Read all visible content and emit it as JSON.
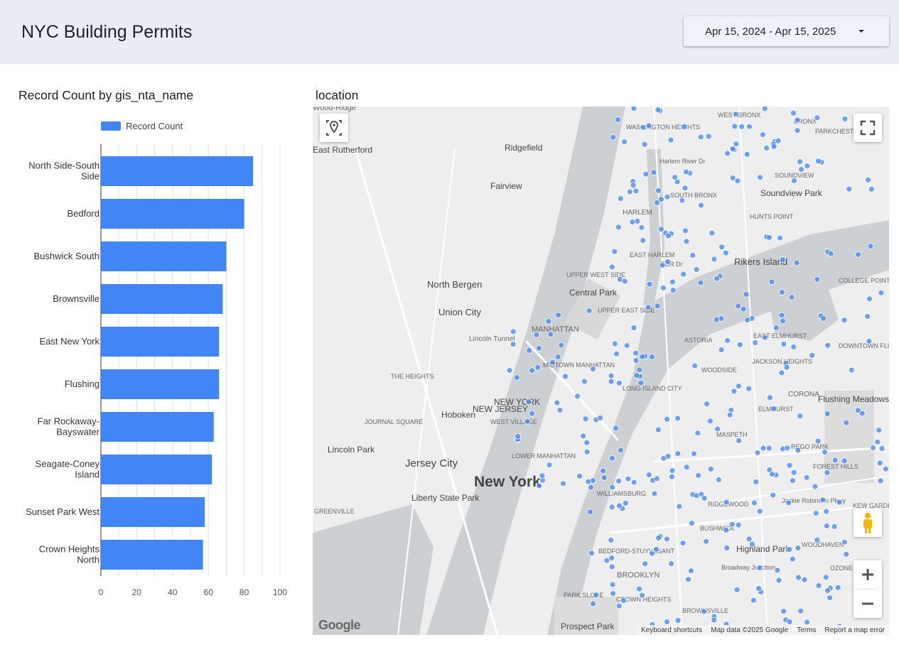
{
  "header": {
    "title": "NYC Building Permits",
    "date_range": "Apr 15, 2024 - Apr 15, 2025"
  },
  "bar_chart": {
    "title": "Record Count by gis_nta_name"
  },
  "map_panel": {
    "title": "location",
    "footer": {
      "shortcuts": "Keyboard shortcuts",
      "map_data": "Map data ©2025 Google",
      "terms": "Terms",
      "report": "Report a map error"
    },
    "logo": "Google",
    "place_labels": [
      "Wood-Ridge",
      "East Rutherford",
      "Ridgefield",
      "Fairview",
      "WASHINGTON HEIGHTS",
      "WEST BRONX",
      "BRONX",
      "PARKCHESTER",
      "SOUNDVIEW",
      "Soundview Park",
      "SOUTH BRONX",
      "HARLEM",
      "HUNTS POINT",
      "EAST HARLEM",
      "Rikers Island",
      "COLLEGE POINT",
      "North Bergen",
      "UPPER WEST SIDE",
      "Central Park",
      "UPPER EAST SIDE",
      "Union City",
      "MANHATTAN",
      "ASTORIA",
      "EAST ELMHURST",
      "JACKSON HEIGHTS",
      "MIDTOWN MANHATTAN",
      "WOODSIDE",
      "THE HEIGHTS",
      "LONG ISLAND CITY",
      "CORONA",
      "Flushing Meadows Corona Park",
      "Hoboken",
      "JOURNAL SQUARE",
      "WEST VILLAGE",
      "ELMHURST",
      "MASPETH",
      "REGO PARK",
      "Lincoln Park",
      "LOWER MANHATTAN",
      "Jersey City",
      "New York",
      "FOREST HILLS",
      "WILLIAMSBURG",
      "Liberty State Park",
      "RIDGEWOOD",
      "GREENVILLE",
      "BUSHWICK",
      "Highland Park",
      "WOODHAVEN",
      "BEDFORD-STUYVESANT",
      "BROOKLYN",
      "OZONE PARK",
      "PARK SLOPE",
      "CROWN HEIGHTS",
      "BROWNSVILLE",
      "Prospect Park",
      "Jackie Robinson Pkwy",
      "Lincoln Tunnel",
      "Harlem River Dr",
      "FDR Dr",
      "NEW JERSEY",
      "NEW YORK",
      "DOWNTOWN FLUSHING",
      "KEW GARDENS",
      "Broadway Junction"
    ]
  },
  "chart_data": {
    "type": "bar",
    "orientation": "horizontal",
    "title": "Record Count by gis_nta_name",
    "xlabel": "",
    "ylabel": "",
    "categories": [
      [
        "North Side-South",
        "Side"
      ],
      [
        "Bedford"
      ],
      [
        "Bushwick South"
      ],
      [
        "Brownsville"
      ],
      [
        "East New York"
      ],
      [
        "Flushing"
      ],
      [
        "Far Rockaway-",
        "Bayswater"
      ],
      [
        "Seagate-Coney",
        "Island"
      ],
      [
        "Sunset Park West"
      ],
      [
        "Crown Heights",
        "North"
      ]
    ],
    "series": [
      {
        "name": "Record Count",
        "color": "#4285f4",
        "values": [
          85,
          80,
          70,
          68,
          66,
          66,
          63,
          62,
          58,
          57
        ]
      }
    ],
    "xlim": [
      0,
      100
    ],
    "ticks": [
      0,
      20,
      40,
      60,
      80,
      100
    ],
    "grid": true,
    "legend_position": "top"
  },
  "colors": {
    "header_bg": "#e8edf6",
    "bar": "#4285f4",
    "marker": "#4285f4"
  }
}
